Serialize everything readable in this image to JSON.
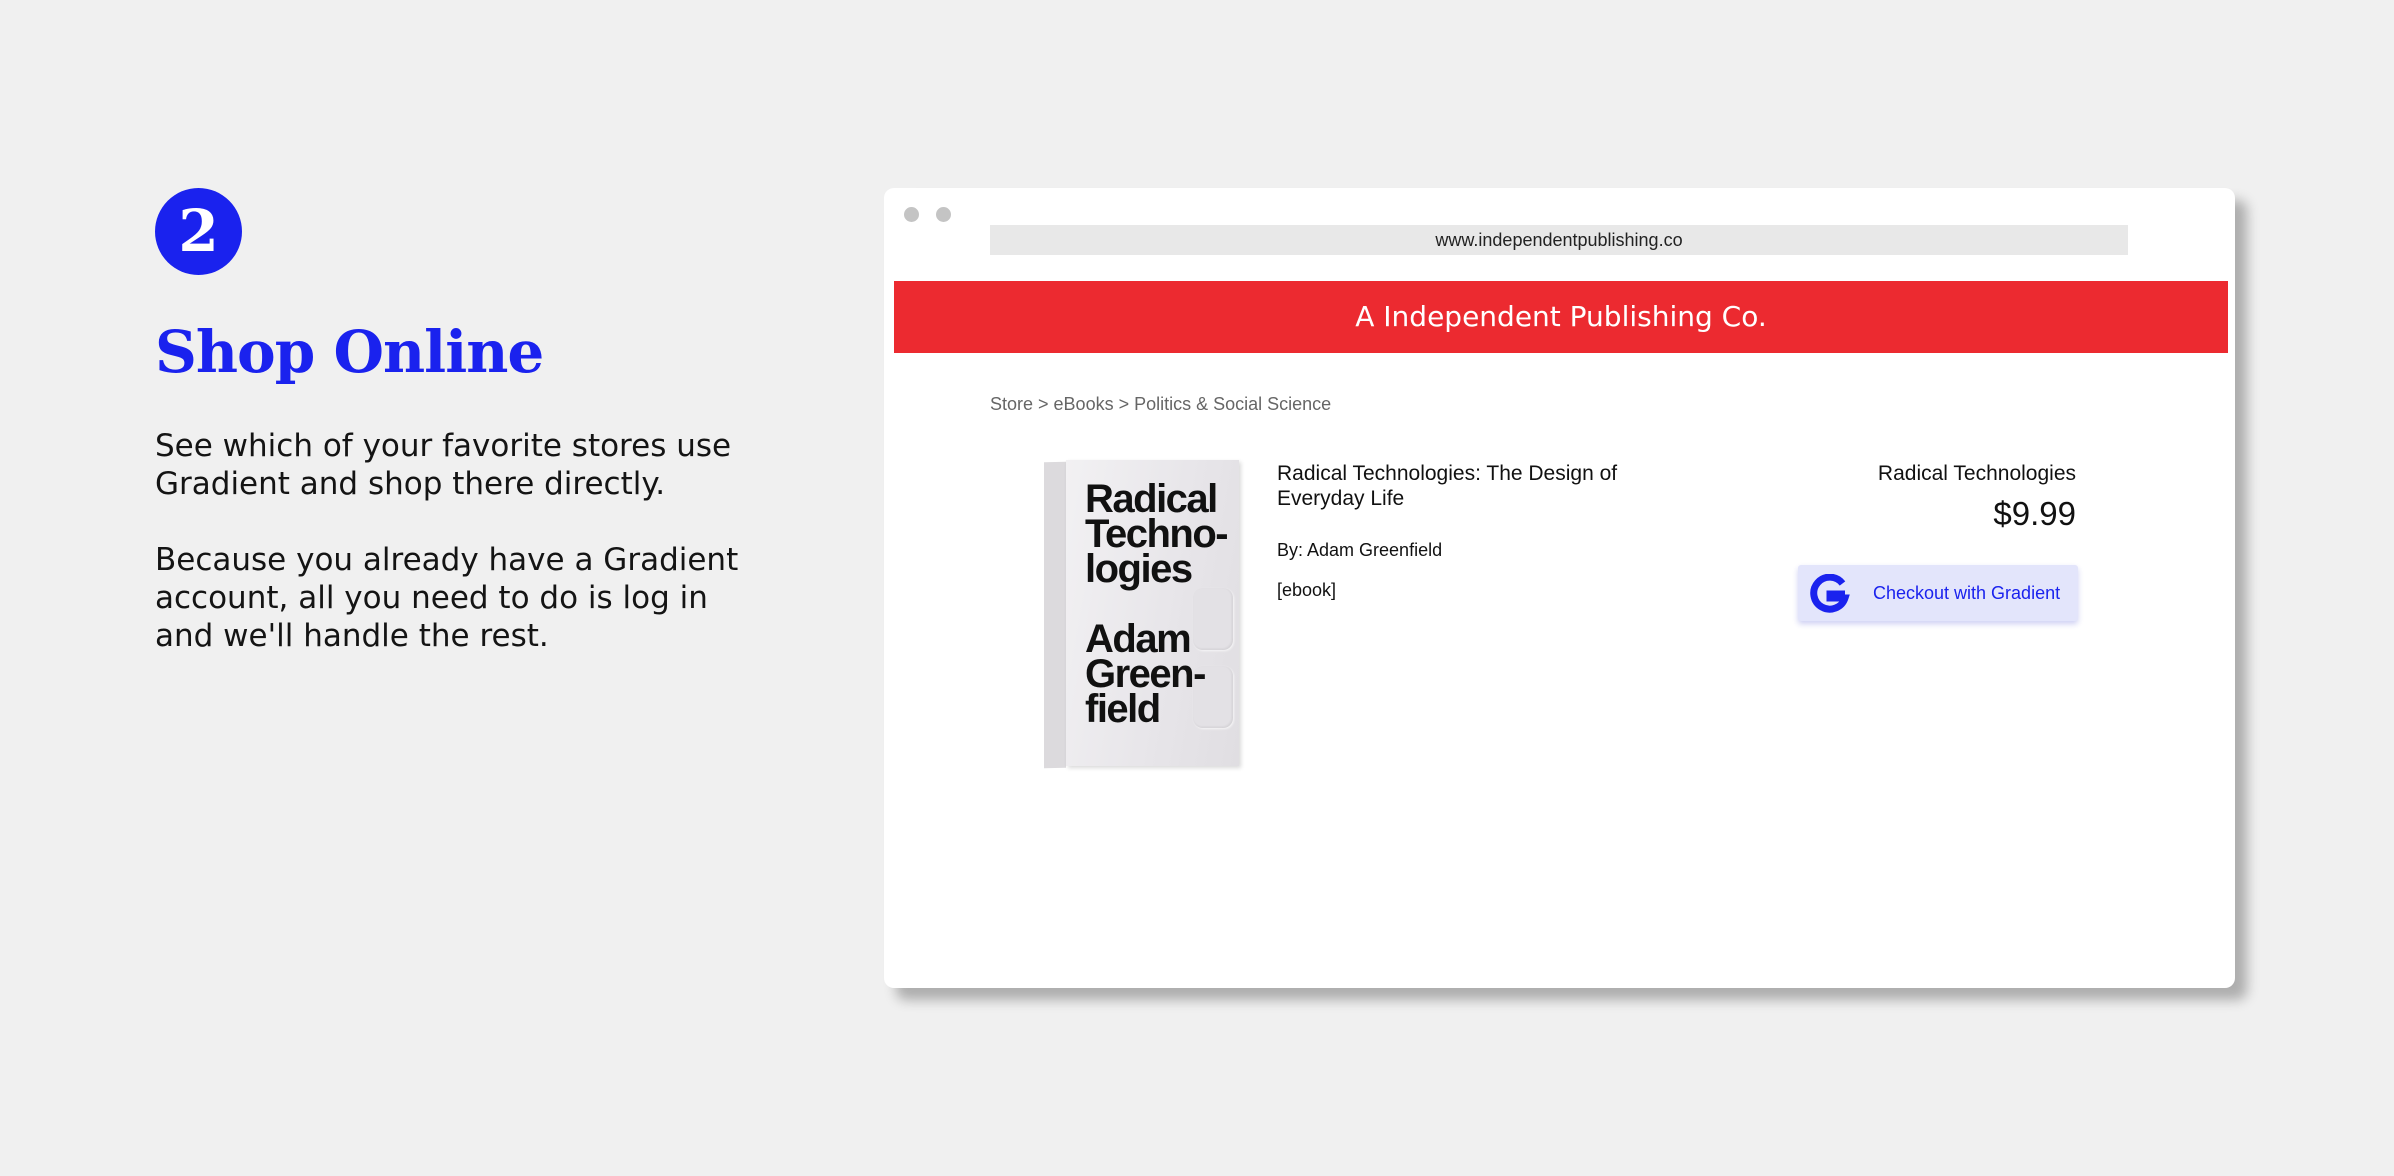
{
  "step": {
    "number": "2",
    "title": "Shop Online",
    "paragraphs": [
      "See which of your favorite stores use Gradient and shop there directly.",
      "Because you already have a Gradient account, all you need to do is log in and we'll handle the rest."
    ]
  },
  "colors": {
    "accent": "#1a22ee",
    "store_header": "#ec2a30",
    "page_background": "#f0f0f0",
    "checkout_button": "#e3e5fb"
  },
  "browser": {
    "url": "www.independentpublishing.co"
  },
  "store": {
    "name": "A Independent Publishing Co.",
    "breadcrumb": "Store > eBooks > Politics & Social Science"
  },
  "book_cover": {
    "title": "Radical\nTechno-\nlogies",
    "author": "Adam\nGreen-\nfield"
  },
  "product": {
    "title": "Radical Technologies: The Design of Everyday Life",
    "author": "By: Adam Greenfield",
    "format": "[ebook]"
  },
  "purchase": {
    "name": "Radical Technologies",
    "price": "$9.99",
    "checkout_label": "Checkout with Gradient",
    "icon": "gradient-g-logo-icon"
  }
}
